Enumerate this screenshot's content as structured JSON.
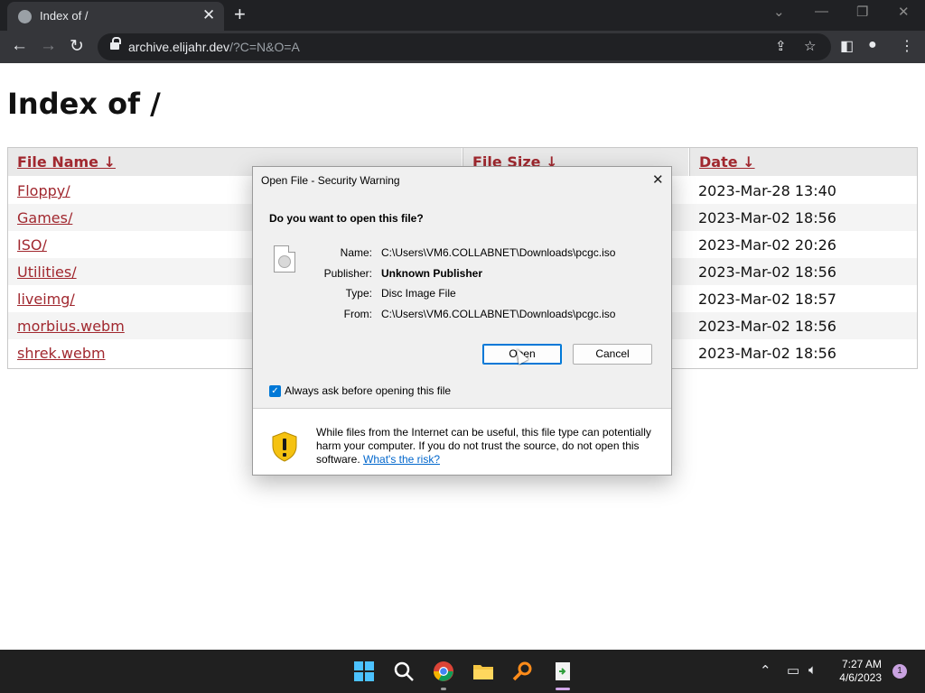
{
  "browser": {
    "tab_title": "Index of /",
    "new_tab_label": "+",
    "url_host": "archive.elijahr.dev",
    "url_path": "/?C=N&O=A"
  },
  "page": {
    "heading": "Index of /",
    "columns": [
      "File Name  ↓",
      "File Size  ↓",
      "Date  ↓"
    ],
    "rows": [
      {
        "name": "Floppy/",
        "date": "2023-Mar-28 13:40"
      },
      {
        "name": "Games/",
        "date": "2023-Mar-02 18:56"
      },
      {
        "name": "ISO/",
        "date": "2023-Mar-02 20:26"
      },
      {
        "name": "Utilities/",
        "date": "2023-Mar-02 18:56"
      },
      {
        "name": "liveimg/",
        "date": "2023-Mar-02 18:57"
      },
      {
        "name": "morbius.webm",
        "date": "2023-Mar-02 18:56"
      },
      {
        "name": "shrek.webm",
        "date": "2023-Mar-02 18:56"
      }
    ]
  },
  "dialog": {
    "title": "Open File - Security Warning",
    "question": "Do you want to open this file?",
    "fields": [
      {
        "label": "Name:",
        "value": "C:\\Users\\VM6.COLLABNET\\Downloads\\pcgc.iso"
      },
      {
        "label": "Publisher:",
        "value": "Unknown Publisher"
      },
      {
        "label": "Type:",
        "value": "Disc Image File"
      },
      {
        "label": "From:",
        "value": "C:\\Users\\VM6.COLLABNET\\Downloads\\pcgc.iso"
      }
    ],
    "open_label": "Open",
    "cancel_label": "Cancel",
    "checkbox_label": "Always ask before opening this file",
    "checkbox_checked": true,
    "warning_text": "While files from the Internet can be useful, this file type can potentially harm your computer. If you do not trust the source, do not open this software.",
    "warning_link": "What's the risk?"
  },
  "taskbar": {
    "time": "7:27 AM",
    "date": "4/6/2023",
    "notification_count": "1"
  }
}
